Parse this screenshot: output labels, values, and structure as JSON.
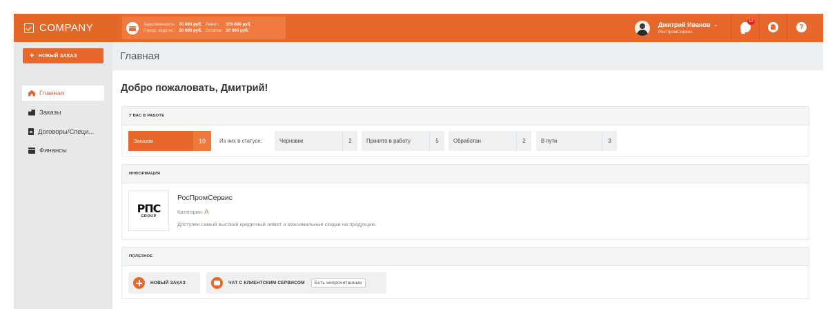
{
  "brand": {
    "name": "COMPANY"
  },
  "credit": {
    "debt_label": "Задолженность:",
    "debt_value": "70 000 руб.",
    "limit_label": "Лимит:",
    "limit_value": "100 000 руб.",
    "overdue_label": "Проср. задолж.:",
    "overdue_value": "50 000 руб.",
    "remaining_label": "Остаток:",
    "remaining_value": "20 000 руб."
  },
  "user": {
    "name": "Дмитрий Иванов",
    "organization": "РосПромСервис",
    "caret": "⌄"
  },
  "notifications": {
    "chat_count": "12",
    "help_symbol": "?"
  },
  "sidebar": {
    "new_order_label": "НОВЫЙ ЗАКАЗ",
    "items": [
      {
        "label": "Главная",
        "icon": "home-icon",
        "active": true
      },
      {
        "label": "Заказы",
        "icon": "boxes-icon",
        "active": false
      },
      {
        "label": "Договоры/Специ...",
        "icon": "document-icon",
        "active": false
      },
      {
        "label": "Финансы",
        "icon": "wallet-icon",
        "active": false
      }
    ]
  },
  "page": {
    "title": "Главная",
    "welcome": "Добро пожаловать, Дмитрий!"
  },
  "work": {
    "heading": "У ВАС В РАБОТЕ",
    "orders_label": "Заказов",
    "orders_count": "10",
    "status_caption": "Из них в статусе:",
    "statuses": [
      {
        "label": "Черновик",
        "count": "2"
      },
      {
        "label": "Принято в работу",
        "count": "5"
      },
      {
        "label": "Обработан",
        "count": "2"
      },
      {
        "label": "В пути",
        "count": "3"
      }
    ]
  },
  "info": {
    "heading": "ИНФОРМАЦИЯ",
    "logo_mark": "РПС",
    "logo_sub": "GROUP",
    "company_name": "РосПромСервис",
    "category_label": "Категория:",
    "category_value": "A",
    "description": "Доступен самый высокий кредитный лимит и максимальные скидки на продукцию."
  },
  "useful": {
    "heading": "ПОЛЕЗНОЕ",
    "new_order_label": "НОВЫЙ ЗАКАЗ",
    "chat_label": "ЧАТ С КЛИЕНТСКИМ СЕРВИСОМ",
    "unread_label": "Есть непрочитанные"
  },
  "colors": {
    "accent": "#e8682b",
    "sidebar_bg": "#e6e8ea",
    "header_bg": "#eceff1"
  }
}
